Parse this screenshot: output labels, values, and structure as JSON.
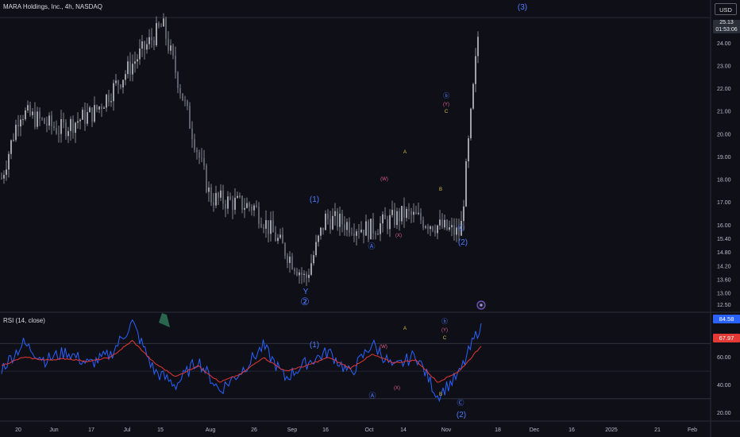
{
  "header": {
    "symbol_info": "MARA Holdings, Inc., 4h, NASDAQ",
    "currency_button": "USD"
  },
  "price_badge": {
    "price": "25.13",
    "countdown": "01:53:06"
  },
  "rsi": {
    "title": "RSI (14, close)",
    "badge_rsi": "84.58",
    "badge_ma": "67.97",
    "colors": {
      "rsi": "#2962ff",
      "ma": "#e53935",
      "rsi_badge": "#2962ff",
      "ma_badge": "#e53935"
    }
  },
  "chart_data": [
    {
      "type": "candlestick",
      "title": "MARA Holdings, Inc., 4h, NASDAQ",
      "ylim": [
        12.2,
        25.9
      ],
      "y_ticks": [
        "24.00",
        "23.00",
        "22.00",
        "21.00",
        "20.00",
        "19.00",
        "18.00",
        "17.00",
        "16.00",
        "15.40",
        "14.80",
        "14.20",
        "13.60",
        "13.00",
        "12.50"
      ],
      "x_ticks": [
        "20",
        "Jun",
        "17",
        "Jul",
        "15",
        "Aug",
        "26",
        "Sep",
        "16",
        "Oct",
        "14",
        "Nov",
        "18",
        "Dec",
        "16",
        "2025",
        "21",
        "Feb"
      ],
      "close_points": [
        {
          "x": "20",
          "y": 17.8
        },
        {
          "x": "Jun",
          "y": 21.0
        },
        {
          "x": "17",
          "y": 20.2
        },
        {
          "x": "Jul",
          "y": 21.0
        },
        {
          "x": "15",
          "y": 24.8
        },
        {
          "x": "Aug",
          "y": 17.2
        },
        {
          "x": "26",
          "y": 16.8
        },
        {
          "x": "Sep",
          "y": 13.6
        },
        {
          "x": "16",
          "y": 16.3
        },
        {
          "x": "Oct",
          "y": 15.8
        },
        {
          "x": "14",
          "y": 16.5
        },
        {
          "x": "Nov",
          "y": 15.6
        },
        {
          "x": "Nov",
          "y": 25.1
        }
      ],
      "wave_labels": [
        "(3)",
        "ⓑ",
        "(Y)",
        "C",
        "A",
        "(W)",
        "(1)",
        "B",
        "Ⓐ",
        "(X)",
        "Ⓒ",
        "(2)",
        "Y",
        "②"
      ],
      "current_price": 25.13
    },
    {
      "type": "line",
      "title": "RSI (14, close)",
      "ylim": [
        15,
        92
      ],
      "y_ticks": [
        "60.00",
        "40.00",
        "20.00"
      ],
      "series": [
        {
          "name": "RSI",
          "values": [
            52,
            70,
            58,
            64,
            55,
            62,
            85,
            50,
            40,
            58,
            36,
            50,
            68,
            45,
            56,
            64,
            48,
            70,
            52,
            62,
            32,
            48,
            84.58
          ]
        },
        {
          "name": "MA",
          "values": [
            54,
            60,
            58,
            59,
            57,
            60,
            72,
            56,
            46,
            54,
            42,
            48,
            60,
            50,
            54,
            60,
            52,
            62,
            56,
            58,
            42,
            50,
            67.97
          ]
        }
      ],
      "levels": [
        70,
        50,
        30
      ],
      "wave_labels": [
        "ⓑ",
        "(Y)",
        "C",
        "A",
        "(W)",
        "(1)",
        "B",
        "Ⓐ",
        "(X)",
        "Ⓒ",
        "(2)"
      ]
    }
  ]
}
